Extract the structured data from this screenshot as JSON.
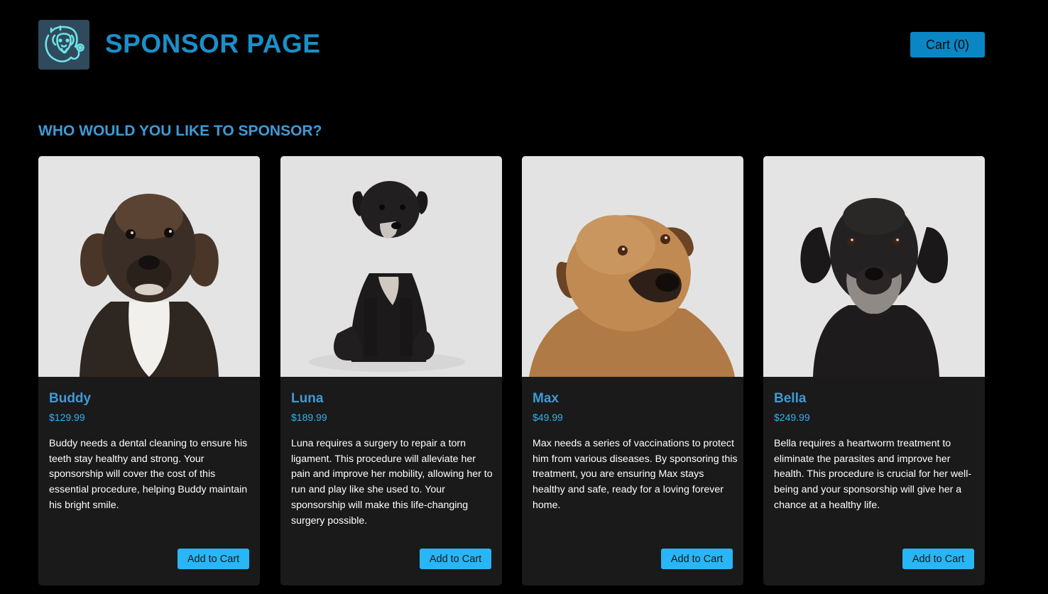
{
  "header": {
    "logo_name": "dog-stethoscope-logo",
    "title": "SPONSOR PAGE",
    "cart_label": "Cart (0)"
  },
  "main": {
    "heading": "WHO WOULD YOU LIKE TO SPONSOR?",
    "cards": [
      {
        "name": "Buddy",
        "price": "$129.99",
        "description": "Buddy needs a dental cleaning to ensure his teeth stay healthy and strong. Your sponsorship will cover the cost of this essential procedure, helping Buddy maintain his bright smile.",
        "button_label": "Add to Cart",
        "photo": "brown-black-puppy-photo"
      },
      {
        "name": "Luna",
        "price": "$189.99",
        "description": "Luna requires a surgery to repair a torn ligament. This procedure will alleviate her pain and improve her mobility, allowing her to run and play like she used to. Your sponsorship will make this life-changing surgery possible.",
        "button_label": "Add to Cart",
        "photo": "small-black-dog-sitting-photo"
      },
      {
        "name": "Max",
        "price": "$49.99",
        "description": "Max needs a series of vaccinations to protect him from various diseases. By sponsoring this treatment, you are ensuring Max stays healthy and safe, ready for a loving forever home.",
        "button_label": "Add to Cart",
        "photo": "tan-dog-portrait-photo"
      },
      {
        "name": "Bella",
        "price": "$249.99",
        "description": "Bella requires a heartworm treatment to eliminate the parasites and improve her health. This procedure is crucial for her well-being and your sponsorship will give her a chance at a healthy life.",
        "button_label": "Add to Cart",
        "photo": "old-black-dog-portrait-photo"
      }
    ]
  },
  "colors": {
    "background": "#000000",
    "title": "#1a8fca",
    "heading": "#3d9ad6",
    "card_background": "#1a1a1a",
    "price": "#29b6f6",
    "button": "#29b6f6",
    "cart_button": "#0b86c4"
  }
}
